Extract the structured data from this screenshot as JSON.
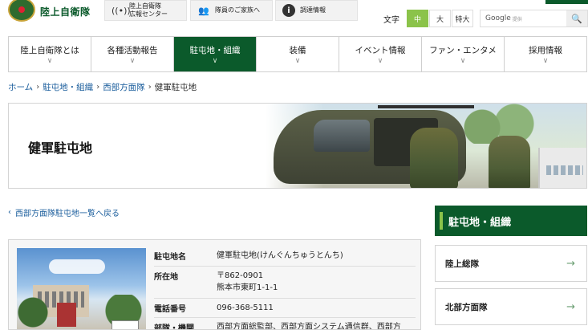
{
  "header": {
    "site_name": "陸上自衛隊",
    "util_links": [
      {
        "icon": "broadcast-icon",
        "glyph": "((•))",
        "label_line1": "陸上自衛隊",
        "label_line2": "広報センター"
      },
      {
        "icon": "family-icon",
        "glyph": "👥",
        "label_line1": "隊員のご家族へ",
        "label_line2": ""
      },
      {
        "icon": "info-icon",
        "glyph": "i",
        "label_line1": "調達情報",
        "label_line2": ""
      }
    ],
    "font_size_label": "文字",
    "font_sizes": [
      "中",
      "大",
      "特大"
    ],
    "search_brand": "Google",
    "search_provider": "提供",
    "search_icon_glyph": "🔍",
    "accent_color": "#0b5a2b",
    "highlight_color": "#8bc34a"
  },
  "nav": {
    "items": [
      "陸上自衛隊とは",
      "各種活動報告",
      "駐屯地・組織",
      "装備",
      "イベント情報",
      "ファン・エンタメ",
      "採用情報"
    ],
    "active_index": 2,
    "chevron": "∨"
  },
  "breadcrumb": {
    "items": [
      "ホーム",
      "駐屯地・組織",
      "西部方面隊"
    ],
    "separator": "›",
    "current": "健軍駐屯地"
  },
  "hero": {
    "title": "健軍駐屯地"
  },
  "back_link": {
    "glyph": "‹",
    "label": "西部方面隊駐屯地一覧へ戻る"
  },
  "info": {
    "rows": [
      {
        "key": "駐屯地名",
        "value": "健軍駐屯地(けんぐんちゅうとんち)",
        "value2": ""
      },
      {
        "key": "所在地",
        "value": "〒862-0901",
        "value2": "熊本市東町1-1-1"
      },
      {
        "key": "電話番号",
        "value": "096-368-5111",
        "value2": ""
      },
      {
        "key": "部隊・機関",
        "value": "西部方面総監部、西部方面システム通信群、西部方",
        "value2": ""
      }
    ]
  },
  "sidebar": {
    "heading": "駐屯地・組織",
    "items": [
      "陸上総隊",
      "北部方面隊"
    ],
    "arrow": "→"
  }
}
